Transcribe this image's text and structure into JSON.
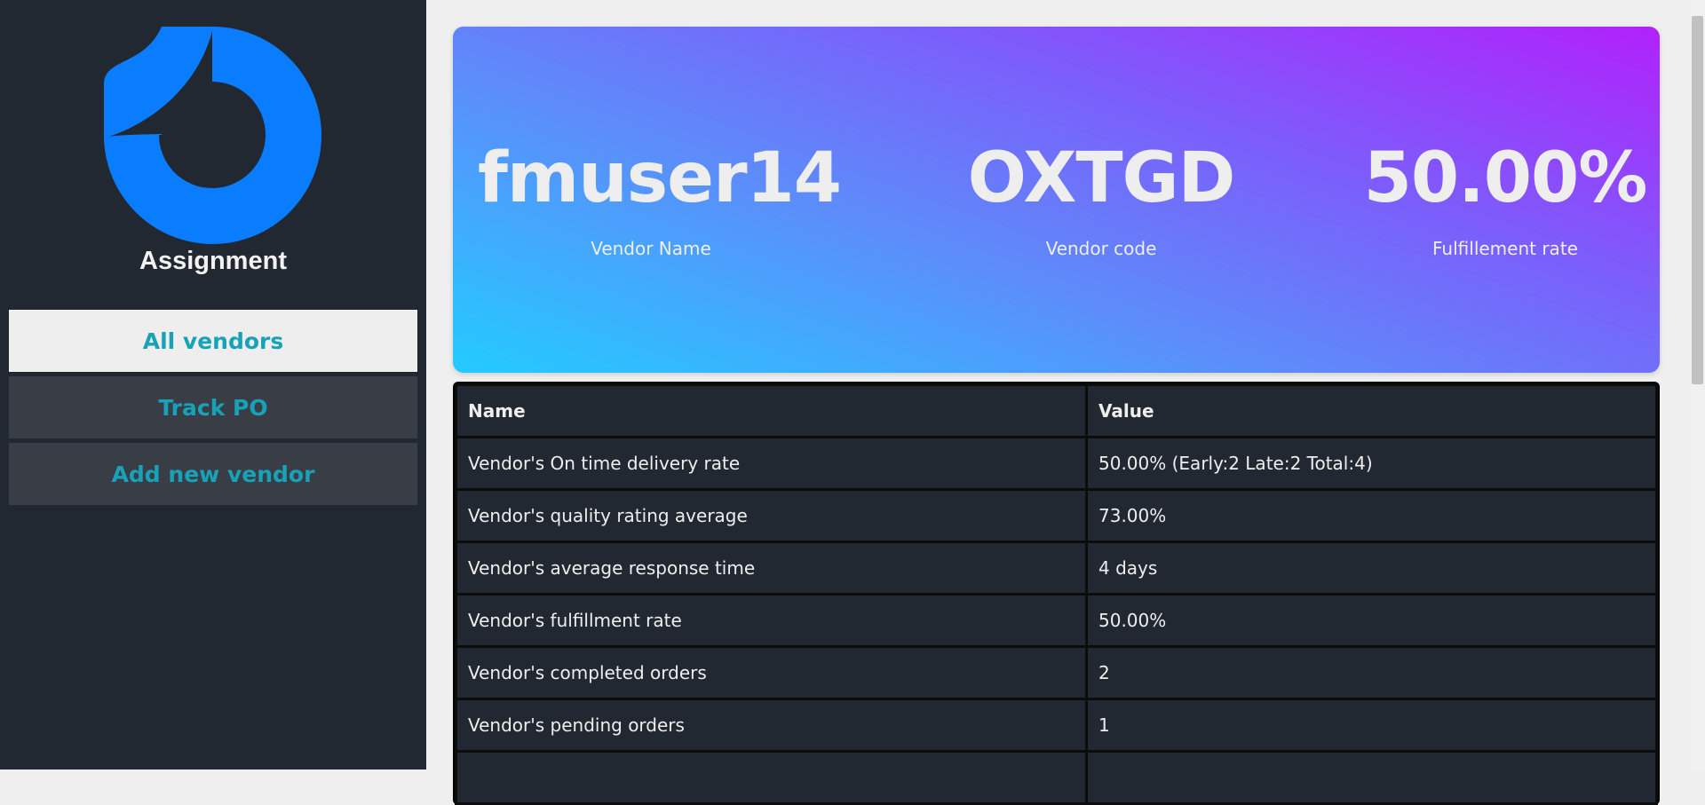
{
  "sidebar": {
    "brand": "Assignment",
    "nav": [
      {
        "label": "All vendors",
        "active": true
      },
      {
        "label": "Track PO",
        "active": false
      },
      {
        "label": "Add new vendor",
        "active": false
      }
    ],
    "logo_icon": "brand-logo-icon",
    "logo_color": "#0a7dff"
  },
  "hero": {
    "vendor_name": "fmuser14",
    "vendor_name_label": "Vendor Name",
    "vendor_code": "OXTGD",
    "vendor_code_label": "Vendor code",
    "fulfillment": "50.00%",
    "fulfillment_label": "Fulfillement rate"
  },
  "table": {
    "headers": [
      "Name",
      "Value"
    ],
    "rows": [
      [
        "Vendor's On time delivery rate",
        "50.00% (Early:2 Late:2 Total:4)"
      ],
      [
        "Vendor's quality rating average",
        "73.00%"
      ],
      [
        "Vendor's average response time",
        "4 days"
      ],
      [
        "Vendor's fulfillment rate",
        "50.00%"
      ],
      [
        "Vendor's completed orders",
        "2"
      ],
      [
        "Vendor's pending orders",
        "1"
      ]
    ]
  },
  "colors": {
    "sidebar_bg": "#222831",
    "nav_text": "#17a2b8",
    "gradient_start": "#23cbff",
    "gradient_end": "#b121fb"
  }
}
